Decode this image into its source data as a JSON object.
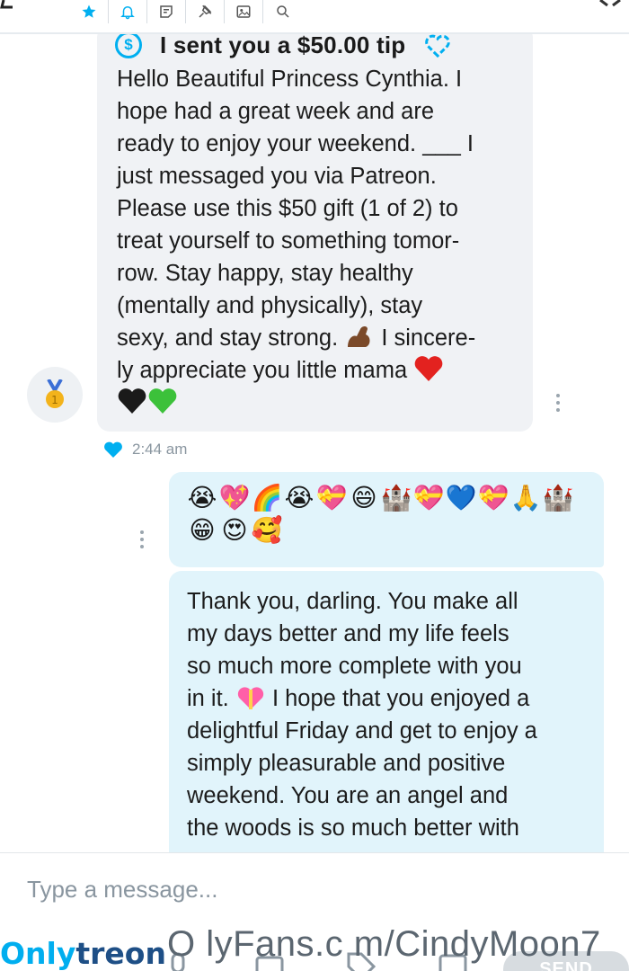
{
  "toolbar": {
    "icons": [
      "back-arrow-icon",
      "star-icon",
      "bell-icon",
      "note-icon",
      "pin-icon",
      "image-icon",
      "search-icon",
      "close-icon"
    ]
  },
  "thread": {
    "tip_message": {
      "tip_label": "I sent you a $50.00 tip",
      "text_lines": [
        "Hello Beautiful Princess Cynthia. I",
        "hope had a great week and are",
        "ready to enjoy your weekend. ___ I",
        "just messaged you via Patreon.",
        "Please use this $50 gift (1 of 2) to",
        "treat yourself to something tomor-",
        "row. Stay happy, stay healthy",
        "(mentally and physically), stay",
        "sexy, and stay strong.",
        "I sincere-",
        "ly appreciate you little mama"
      ],
      "time": "2:44 am"
    },
    "emoji_message": {
      "emojis": [
        "😭",
        "💖",
        "🌈",
        "😭",
        "💝",
        "😄",
        "🏰",
        "💝",
        "💙",
        "💝",
        "🙏",
        "🏰",
        "😁",
        "😍",
        "🥰"
      ]
    },
    "reply_message": {
      "text_lines": [
        "Thank you, darling. You make all",
        "my days better and my life feels",
        "so much more complete with you",
        "in it.",
        " I hope that you enjoyed a",
        "delightful Friday and get to enjoy a",
        "simply pleasurable and positive",
        "weekend. You are an angel and",
        "the woods is so much better with"
      ]
    }
  },
  "composer": {
    "placeholder": "Type a message...",
    "send_label": "SEND"
  },
  "watermark": {
    "brand_left_a": "Only",
    "brand_left_b": "treon",
    "url_text": "O lyFans.c m/CindyMoon7"
  },
  "colors": {
    "accent": "#00aff0",
    "bubble_in": "#f0f2f5",
    "bubble_out": "#e1f4fb",
    "muted": "#8a96a0"
  }
}
